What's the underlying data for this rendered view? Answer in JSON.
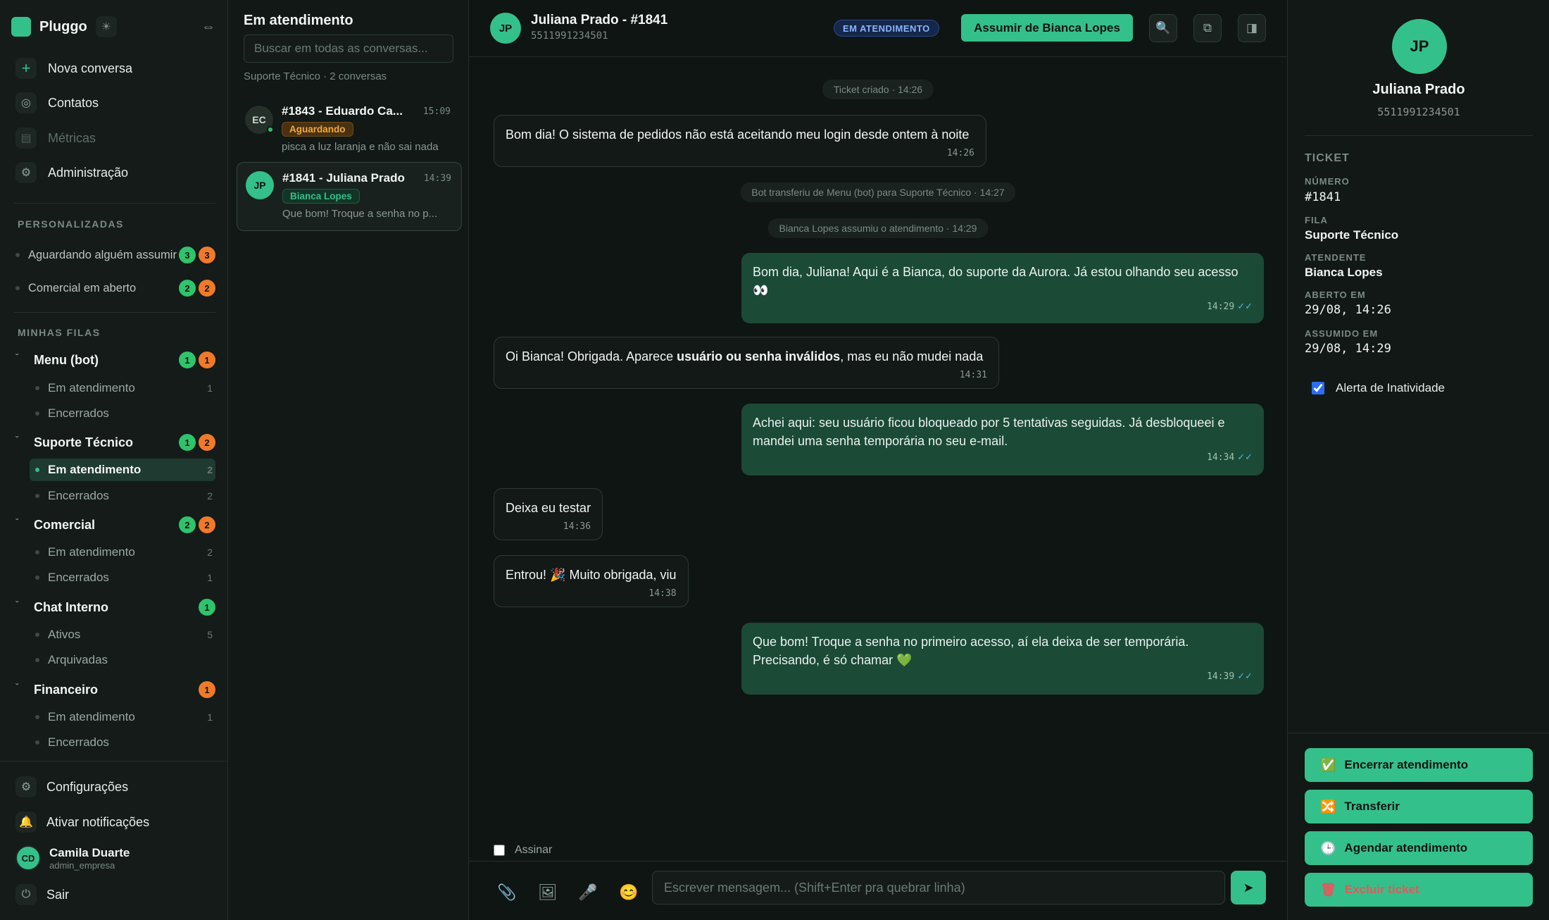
{
  "app": {
    "name": "Pluggo"
  },
  "nav": {
    "new_conversation": "Nova conversa",
    "contacts": "Contatos",
    "metrics": "Métricas",
    "admin": "Administração"
  },
  "custom": {
    "heading": "PERSONALIZADAS",
    "items": [
      {
        "label": "Aguardando alguém assumir",
        "green": "3",
        "orange": "3"
      },
      {
        "label": "Comercial em aberto",
        "green": "2",
        "orange": "2"
      }
    ]
  },
  "queues": {
    "heading": "MINHAS FILAS",
    "items": [
      {
        "name": "Menu (bot)",
        "green": "1",
        "orange": "1",
        "subs": [
          {
            "label": "Em atendimento",
            "count": "1"
          },
          {
            "label": "Encerrados",
            "count": ""
          }
        ]
      },
      {
        "name": "Suporte Técnico",
        "green": "1",
        "orange": "2",
        "subs": [
          {
            "label": "Em atendimento",
            "count": "2"
          },
          {
            "label": "Encerrados",
            "count": "2"
          }
        ]
      },
      {
        "name": "Comercial",
        "green": "2",
        "orange": "2",
        "subs": [
          {
            "label": "Em atendimento",
            "count": "2"
          },
          {
            "label": "Encerrados",
            "count": "1"
          }
        ]
      },
      {
        "name": "Chat Interno",
        "green": "1",
        "orange": "",
        "subs": [
          {
            "label": "Ativos",
            "count": "5"
          },
          {
            "label": "Arquivadas",
            "count": ""
          }
        ]
      },
      {
        "name": "Financeiro",
        "green": "",
        "orange": "1",
        "subs": [
          {
            "label": "Em atendimento",
            "count": "1"
          },
          {
            "label": "Encerrados",
            "count": ""
          }
        ]
      }
    ]
  },
  "footer": {
    "settings": "Configurações",
    "notifications": "Ativar notificações",
    "user": {
      "initials": "CD",
      "name": "Camila Duarte",
      "role": "admin_empresa"
    },
    "logout": "Sair"
  },
  "conv_list": {
    "title": "Em atendimento",
    "search_placeholder": "Buscar em todas as conversas...",
    "subtitle": "Suporte Técnico · 2 conversas",
    "items": [
      {
        "initials": "EC",
        "title": "#1843 - Eduardo Ca...",
        "time": "15:09",
        "tag": "Aguardando",
        "preview": "pisca a luz laranja e não sai nada"
      },
      {
        "initials": "JP",
        "title": "#1841 - Juliana Prado",
        "time": "14:39",
        "tag": "Bianca Lopes",
        "preview": "Que bom! Troque a senha no p..."
      }
    ]
  },
  "chat": {
    "initials": "JP",
    "name": "Juliana Prado - #1841",
    "phone": "5511991234501",
    "status": "EM ATENDIMENTO",
    "assume_label": "Assumir de Bianca Lopes",
    "system": [
      "Ticket criado · 14:26",
      "Bot transferiu de Menu (bot) para Suporte Técnico · 14:27",
      "Bianca Lopes assumiu o atendimento · 14:29"
    ],
    "messages": [
      {
        "text": "Bom dia! O sistema de pedidos não está aceitando meu login desde ontem à noite",
        "time": "14:26"
      },
      {
        "text1": "Bom dia, Juliana! Aqui é a Bianca, do suporte da Aurora. Já estou olhando seu acesso",
        "text2": "👀",
        "time": "14:29"
      },
      {
        "pre": "Oi Bianca! Obrigada. Aparece ",
        "bold": "usuário ou senha inválidos",
        "post": ", mas eu não mudei nada",
        "time": "14:31"
      },
      {
        "text1": "Achei aqui: seu usuário ficou bloqueado por 5 tentativas seguidas. Já desbloqueei e",
        "text2": "mandei uma senha temporária no seu e-mail.",
        "time": "14:34"
      },
      {
        "text": "Deixa eu testar",
        "time": "14:36"
      },
      {
        "text": "Entrou! 🎉 Muito obrigada, viu",
        "time": "14:38"
      },
      {
        "text1": "Que bom! Troque a senha no primeiro acesso, aí ela deixa de ser temporária.",
        "text2": "Precisando, é só chamar 💚",
        "time": "14:39"
      }
    ],
    "ticks": "✓✓",
    "sign_label": "Assinar",
    "composer_placeholder": "Escrever mensagem... (Shift+Enter pra quebrar linha)"
  },
  "details": {
    "initials": "JP",
    "name": "Juliana Prado",
    "phone": "5511991234501",
    "section": "TICKET",
    "fields": [
      {
        "label": "NÚMERO",
        "value": "#1841"
      },
      {
        "label": "FILA",
        "value": "Suporte Técnico"
      },
      {
        "label": "ATENDENTE",
        "value": "Bianca Lopes"
      },
      {
        "label": "ABERTO EM",
        "value": "29/08, 14:26"
      },
      {
        "label": "ASSUMIDO EM",
        "value": "29/08, 14:29"
      }
    ],
    "inactivity_alert": "Alerta de Inatividade",
    "actions": {
      "close": "Encerrar atendimento",
      "transfer": "Transferir",
      "schedule": "Agendar atendimento",
      "delete": "Excluir ticket"
    }
  },
  "colors": {
    "accent": "#34c08a",
    "badge_green": "#2fc36b",
    "badge_orange": "#f07a2a",
    "danger": "#e8565b",
    "status_blue": "#8ab4ff"
  },
  "icons": [
    "sun-icon",
    "collapse-icon",
    "plus-icon",
    "contacts-icon",
    "chart-icon",
    "gear-icon",
    "bell-icon",
    "power-icon",
    "search-icon",
    "copy-icon",
    "panel-icon",
    "paperclip-icon",
    "image-icon",
    "microphone-icon",
    "emoji-icon",
    "send-icon",
    "check-icon",
    "shuffle-icon",
    "clock-icon",
    "trash-icon"
  ]
}
